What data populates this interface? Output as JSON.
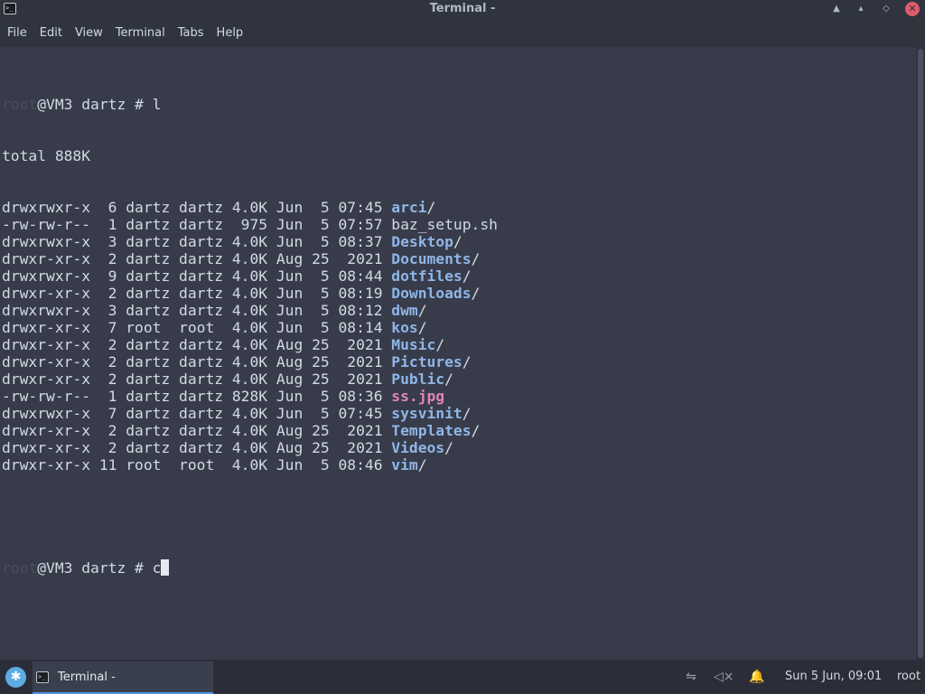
{
  "window": {
    "title": "Terminal -",
    "icon": "terminal-icon",
    "buttons": {
      "minimize": "▲",
      "maximize": "▴",
      "restore": "◇",
      "close": "✕"
    }
  },
  "menu": [
    "File",
    "Edit",
    "View",
    "Terminal",
    "Tabs",
    "Help"
  ],
  "terminal": {
    "prompt_user": "root",
    "prompt_rest": "@VM3 dartz # ",
    "command1": "l",
    "total": "total 888K",
    "listing": [
      {
        "meta": "drwxrwxr-x  6 dartz dartz 4.0K Jun  5 07:45 ",
        "name": "arci",
        "suffix": "/",
        "type": "dir"
      },
      {
        "meta": "-rw-rw-r--  1 dartz dartz  975 Jun  5 07:57 ",
        "name": "baz_setup.sh",
        "suffix": "",
        "type": "file"
      },
      {
        "meta": "drwxrwxr-x  3 dartz dartz 4.0K Jun  5 08:37 ",
        "name": "Desktop",
        "suffix": "/",
        "type": "dir"
      },
      {
        "meta": "drwxr-xr-x  2 dartz dartz 4.0K Aug 25  2021 ",
        "name": "Documents",
        "suffix": "/",
        "type": "dir"
      },
      {
        "meta": "drwxrwxr-x  9 dartz dartz 4.0K Jun  5 08:44 ",
        "name": "dotfiles",
        "suffix": "/",
        "type": "dir"
      },
      {
        "meta": "drwxr-xr-x  2 dartz dartz 4.0K Jun  5 08:19 ",
        "name": "Downloads",
        "suffix": "/",
        "type": "dir"
      },
      {
        "meta": "drwxrwxr-x  3 dartz dartz 4.0K Jun  5 08:12 ",
        "name": "dwm",
        "suffix": "/",
        "type": "dir"
      },
      {
        "meta": "drwxr-xr-x  7 root  root  4.0K Jun  5 08:14 ",
        "name": "kos",
        "suffix": "/",
        "type": "dir"
      },
      {
        "meta": "drwxr-xr-x  2 dartz dartz 4.0K Aug 25  2021 ",
        "name": "Music",
        "suffix": "/",
        "type": "dir"
      },
      {
        "meta": "drwxr-xr-x  2 dartz dartz 4.0K Aug 25  2021 ",
        "name": "Pictures",
        "suffix": "/",
        "type": "dir"
      },
      {
        "meta": "drwxr-xr-x  2 dartz dartz 4.0K Aug 25  2021 ",
        "name": "Public",
        "suffix": "/",
        "type": "dir"
      },
      {
        "meta": "-rw-rw-r--  1 dartz dartz 828K Jun  5 08:36 ",
        "name": "ss.jpg",
        "suffix": "",
        "type": "image"
      },
      {
        "meta": "drwxrwxr-x  7 dartz dartz 4.0K Jun  5 07:45 ",
        "name": "sysvinit",
        "suffix": "/",
        "type": "dir"
      },
      {
        "meta": "drwxr-xr-x  2 dartz dartz 4.0K Aug 25  2021 ",
        "name": "Templates",
        "suffix": "/",
        "type": "dir"
      },
      {
        "meta": "drwxr-xr-x  2 dartz dartz 4.0K Aug 25  2021 ",
        "name": "Videos",
        "suffix": "/",
        "type": "dir"
      },
      {
        "meta": "drwxr-xr-x 11 root  root  4.0K Jun  5 08:46 ",
        "name": "vim",
        "suffix": "/",
        "type": "dir"
      }
    ],
    "command2": "c"
  },
  "taskbar": {
    "start_icon": "app-menu-icon",
    "start_glyph": "✱",
    "task_label": "Terminal -",
    "tray": {
      "network_icon": "network-disconnected-icon",
      "network_glyph": "⇋",
      "volume_icon": "volume-muted-icon",
      "volume_glyph": "◁×",
      "notification_icon": "notification-bell-icon",
      "notification_glyph": "🔔"
    },
    "clock": "Sun  5 Jun, 09:01",
    "user": "root"
  },
  "colors": {
    "background": "#383c4a",
    "directory": "#8fb6e8",
    "image_file": "#e085b3",
    "prompt_user": "#4a4e5a"
  }
}
